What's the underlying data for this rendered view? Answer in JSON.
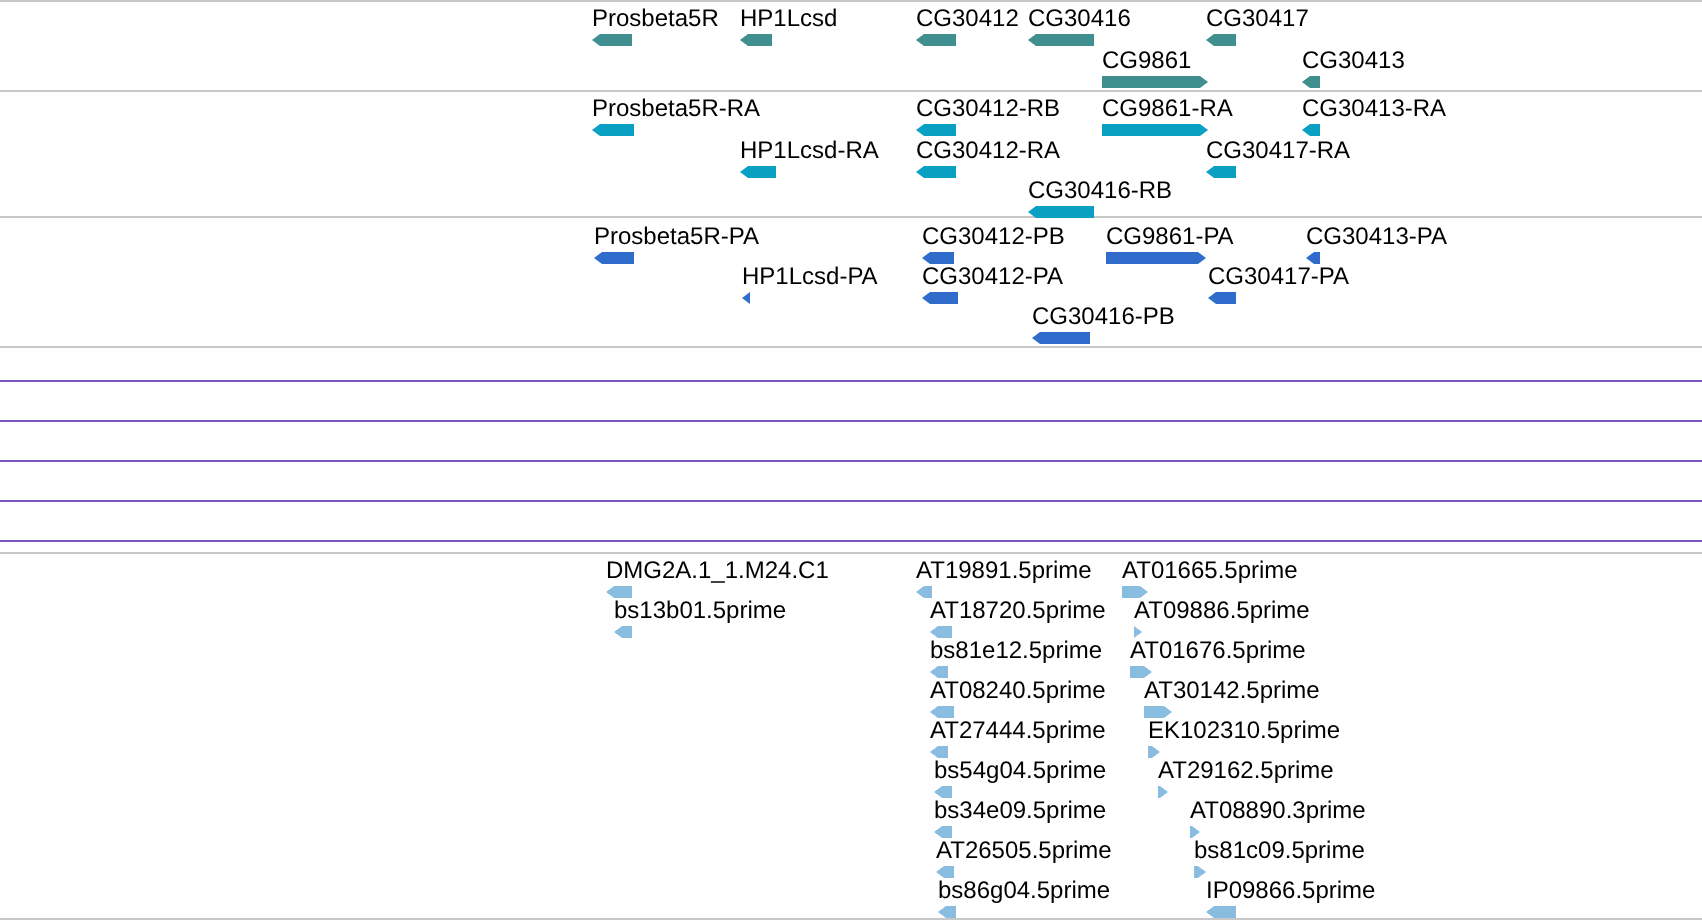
{
  "tracks": [
    {
      "kind": "gene",
      "color": "#3f8f8f",
      "features": [
        {
          "label": "Prosbeta5R",
          "forward": false
        },
        {
          "label": "HP1Lcsd",
          "forward": false
        },
        {
          "label": "CG30412",
          "forward": false
        },
        {
          "label": "CG30416",
          "forward": false
        },
        {
          "label": "CG30417",
          "forward": false
        },
        {
          "label": "CG9861",
          "forward": true
        },
        {
          "label": "CG30413",
          "forward": false
        }
      ]
    },
    {
      "kind": "transcript",
      "color": "#0aa0c4",
      "features": [
        {
          "label": "Prosbeta5R-RA",
          "forward": false
        },
        {
          "label": "CG30412-RB",
          "forward": false
        },
        {
          "label": "CG9861-RA",
          "forward": true
        },
        {
          "label": "CG30413-RA",
          "forward": false
        },
        {
          "label": "HP1Lcsd-RA",
          "forward": false
        },
        {
          "label": "CG30412-RA",
          "forward": false
        },
        {
          "label": "CG30417-RA",
          "forward": false
        },
        {
          "label": "CG30416-RB",
          "forward": false
        }
      ]
    },
    {
      "kind": "protein",
      "color": "#2f6ccc",
      "features": [
        {
          "label": "Prosbeta5R-PA",
          "forward": false
        },
        {
          "label": "CG30412-PB",
          "forward": false
        },
        {
          "label": "CG9861-PA",
          "forward": true
        },
        {
          "label": "CG30413-PA",
          "forward": false
        },
        {
          "label": "HP1Lcsd-PA",
          "forward": false
        },
        {
          "label": "CG30412-PA",
          "forward": false
        },
        {
          "label": "CG30417-PA",
          "forward": false
        },
        {
          "label": "CG30416-PB",
          "forward": false
        }
      ]
    },
    {
      "kind": "est",
      "color": "#88bde0",
      "features": [
        {
          "label": "DMG2A.1_1.M24.C1",
          "forward": false
        },
        {
          "label": "bs13b01.5prime",
          "forward": false
        },
        {
          "label": "AT19891.5prime",
          "forward": false
        },
        {
          "label": "AT18720.5prime",
          "forward": false
        },
        {
          "label": "bs81e12.5prime",
          "forward": false
        },
        {
          "label": "AT08240.5prime",
          "forward": false
        },
        {
          "label": "AT27444.5prime",
          "forward": false
        },
        {
          "label": "bs54g04.5prime",
          "forward": false
        },
        {
          "label": "bs34e09.5prime",
          "forward": false
        },
        {
          "label": "AT26505.5prime",
          "forward": false
        },
        {
          "label": "bs86g04.5prime",
          "forward": false
        },
        {
          "label": "AT01665.5prime",
          "forward": true
        },
        {
          "label": "AT09886.5prime",
          "forward": true
        },
        {
          "label": "AT01676.5prime",
          "forward": true
        },
        {
          "label": "AT30142.5prime",
          "forward": true
        },
        {
          "label": "EK102310.5prime",
          "forward": true
        },
        {
          "label": "AT29162.5prime",
          "forward": true
        },
        {
          "label": "AT08890.3prime",
          "forward": true
        },
        {
          "label": "bs81c09.5prime",
          "forward": true
        },
        {
          "label": "IP09866.5prime",
          "forward": false
        }
      ]
    }
  ]
}
